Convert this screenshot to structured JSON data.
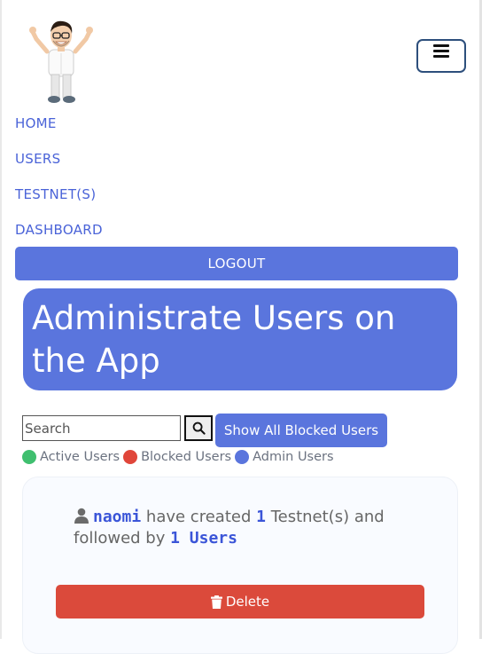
{
  "nav": {
    "items": [
      {
        "label": "HOME"
      },
      {
        "label": "USERS"
      },
      {
        "label": "TESTNET(S)"
      },
      {
        "label": "DASHBOARD"
      }
    ],
    "logout_label": "LOGOUT"
  },
  "hero": {
    "title": "Administrate Users on the App"
  },
  "search": {
    "placeholder": "Search"
  },
  "toolbar": {
    "blocked_users_label": "Show All Blocked Users"
  },
  "legend": [
    {
      "label": "Active Users",
      "color": "#3fbf6f"
    },
    {
      "label": "Blocked Users",
      "color": "#e0463a"
    },
    {
      "label": "Admin Users",
      "color": "#5a75dd"
    }
  ],
  "user_card": {
    "username": "naomi",
    "text_created": "have created",
    "testnet_count": "1",
    "text_testnets": "Testnet(s) and followed by",
    "followers_count": "1 Users",
    "delete_label": "Delete"
  },
  "colors": {
    "accent": "#5a75dd",
    "danger": "#db4a3b"
  }
}
